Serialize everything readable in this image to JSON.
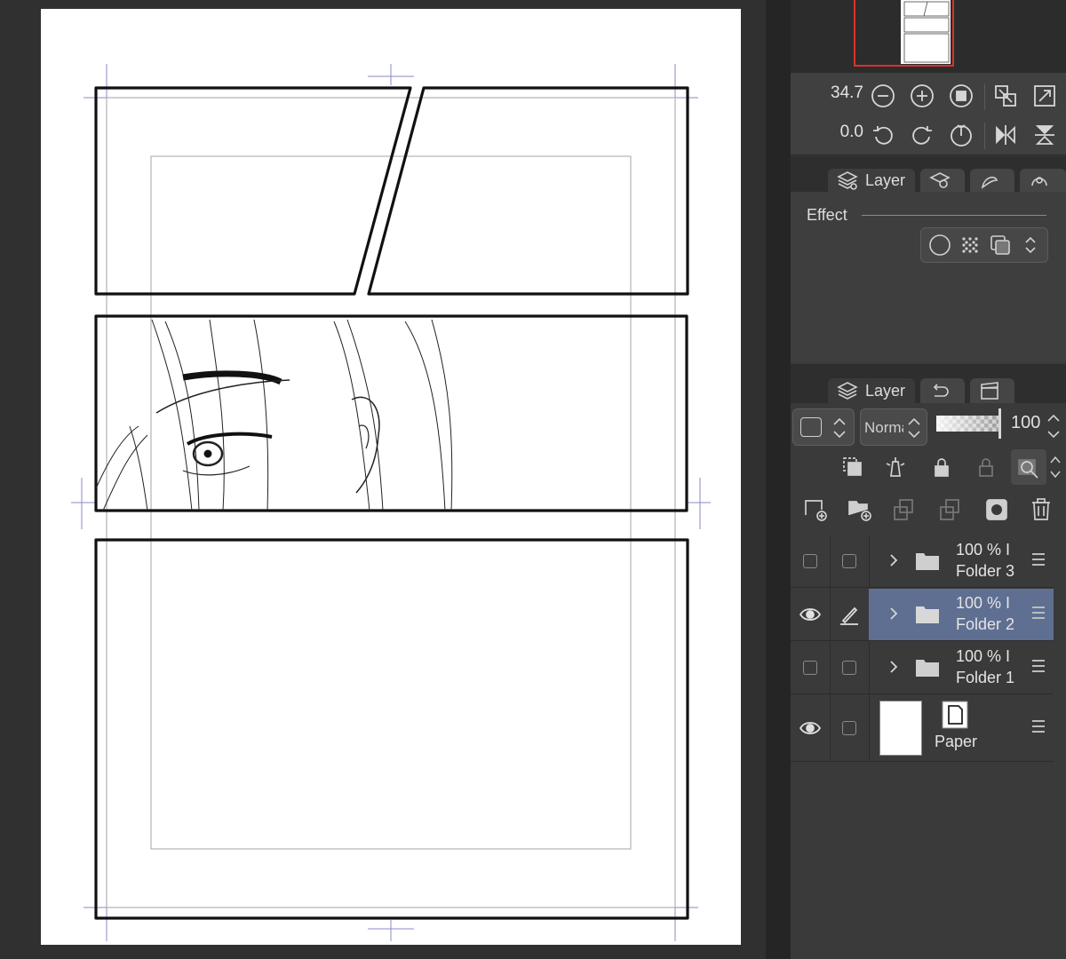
{
  "app": {
    "accent_selection": "#5e6f92",
    "panel_bg": "#3a3a3a"
  },
  "navigator": {
    "zoom_value": "34.7",
    "rotation_value": "0.0",
    "zoom_buttons": [
      "zoom-out-icon",
      "zoom-in-icon",
      "zoom-fit-icon"
    ],
    "rotate_buttons": [
      "rotate-left-icon",
      "rotate-right-icon",
      "reset-rotation-icon"
    ],
    "view_buttons": [
      "fit-page-icon",
      "actual-size-icon",
      "flip-horizontal-icon",
      "flip-vertical-icon"
    ]
  },
  "property_panel": {
    "tab_label": "Layer",
    "effect_label": "Effect"
  },
  "layer_panel": {
    "tab_label": "Layer",
    "blend_mode": "Norma",
    "opacity": "100",
    "layers": [
      {
        "percent": "100 % I",
        "name": "Folder 3",
        "visible": false,
        "editing": false,
        "selected": false,
        "type": "folder"
      },
      {
        "percent": "100 % I",
        "name": "Folder 2",
        "visible": true,
        "editing": true,
        "selected": true,
        "type": "folder"
      },
      {
        "percent": "100 % I",
        "name": "Folder 1",
        "visible": false,
        "editing": false,
        "selected": false,
        "type": "folder"
      },
      {
        "percent": "",
        "name": "Paper",
        "visible": true,
        "editing": false,
        "selected": false,
        "type": "paper"
      }
    ]
  }
}
